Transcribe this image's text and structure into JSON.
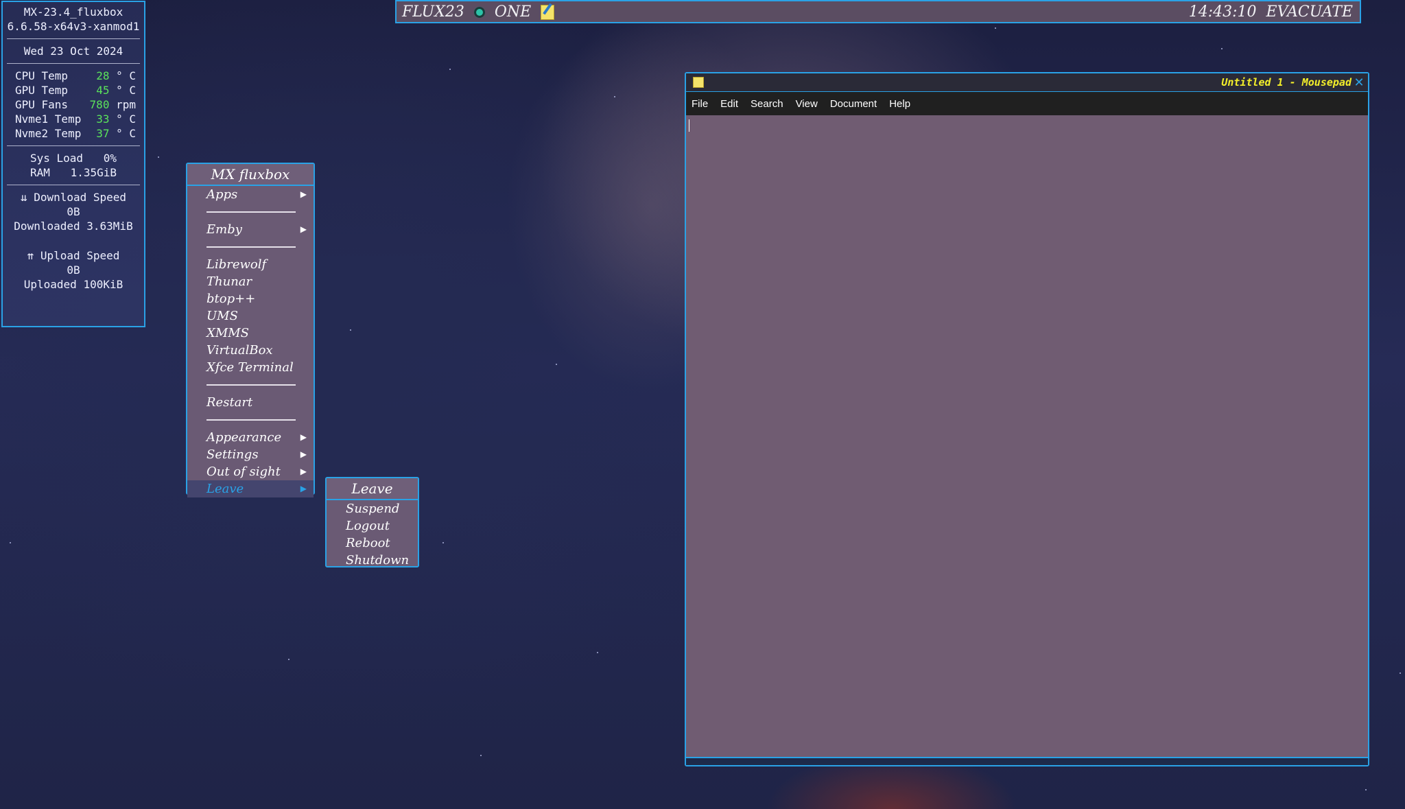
{
  "conky": {
    "hostname": "MX-23.4_fluxbox",
    "kernel": "6.6.58-x64v3-xanmod1",
    "date": "Wed 23 Oct 2024",
    "sensors": [
      {
        "label": "CPU Temp",
        "value": "28",
        "unit": "° C"
      },
      {
        "label": "GPU Temp",
        "value": "45",
        "unit": "° C"
      },
      {
        "label": "GPU Fans",
        "value": "780",
        "unit": "rpm"
      },
      {
        "label": "Nvme1 Temp",
        "value": "33",
        "unit": "° C"
      },
      {
        "label": "Nvme2 Temp",
        "value": "37",
        "unit": "° C"
      }
    ],
    "sys_load_label": "Sys Load",
    "sys_load_value": "0%",
    "ram_label": "RAM",
    "ram_value": "1.35GiB",
    "download_speed_label": "⇊ Download Speed",
    "download_speed_value": "0B",
    "downloaded_label": "Downloaded",
    "downloaded_value": "3.63MiB",
    "upload_speed_label": "⇈ Upload Speed",
    "upload_speed_value": "0B",
    "uploaded_label": "Uploaded",
    "uploaded_value": "100KiB"
  },
  "toolbar": {
    "brand": "FLUX23",
    "workspace": "ONE",
    "clock": "14:43:10",
    "exit_label": "EVACUATE"
  },
  "root_menu": {
    "title": "MX fluxbox",
    "items": [
      "Apps",
      "Emby",
      "Librewolf",
      "Thunar",
      "btop++",
      "UMS",
      "XMMS",
      "VirtualBox",
      "Xfce Terminal",
      "Restart",
      "Appearance",
      "Settings",
      "Out of sight",
      "Leave"
    ],
    "submenu_arrow": "▶"
  },
  "leave_menu": {
    "title": "Leave",
    "items": [
      "Suspend",
      "Logout",
      "Reboot",
      "Shutdown"
    ]
  },
  "mousepad": {
    "title": "Untitled 1 - Mousepad",
    "close_glyph": "✕",
    "menus": [
      "File",
      "Edit",
      "Search",
      "View",
      "Document",
      "Help"
    ]
  },
  "colors": {
    "border_accent": "#2aa2e6",
    "menu_bg": "#6a5a74",
    "editor_bg": "#705c72",
    "value_green": "#5be35b",
    "title_yellow": "#f3ee2a"
  }
}
